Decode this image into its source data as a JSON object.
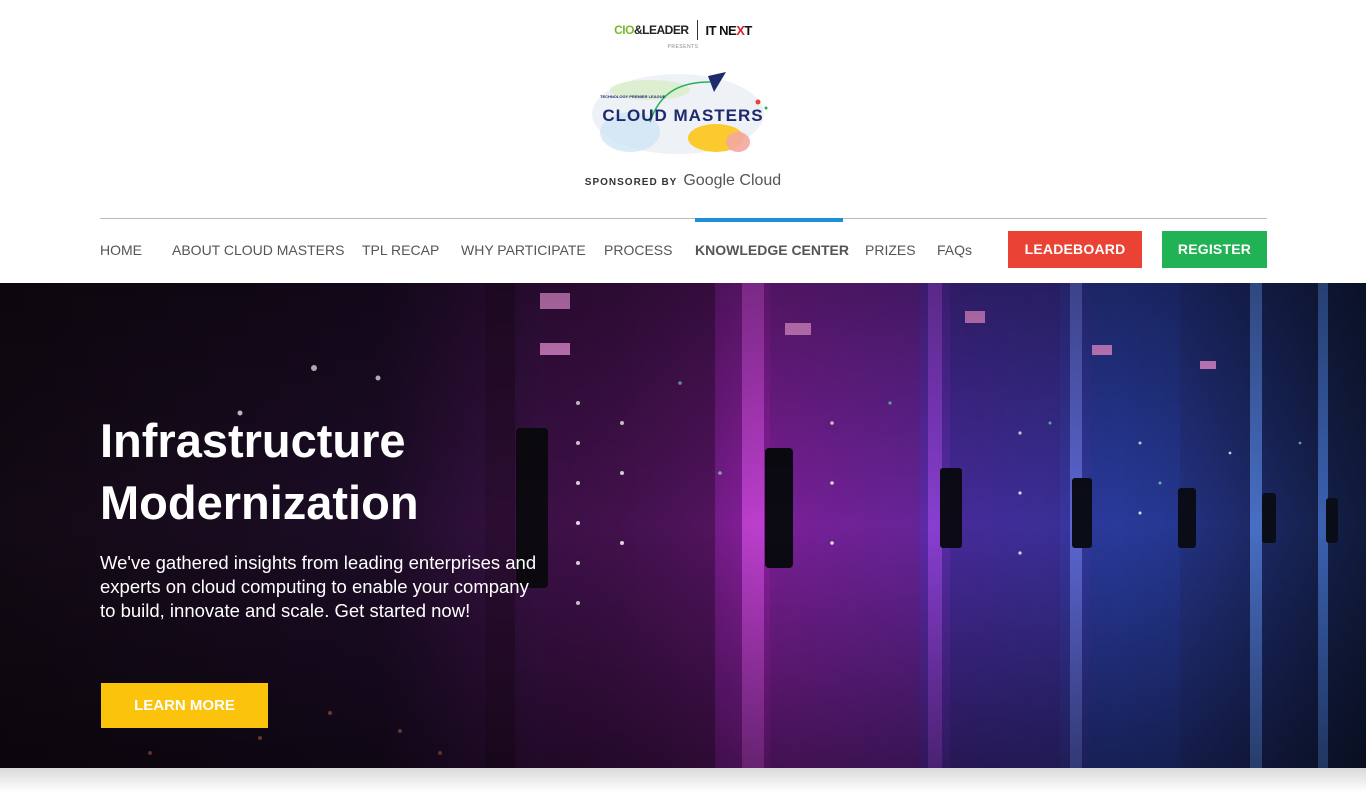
{
  "brand": {
    "cio_a": "CIO",
    "cio_b": "&LEADER",
    "itnext_a": "IT NE",
    "itnext_b": "X",
    "itnext_c": "T",
    "presents": "PRESENTS",
    "logo_tagline": "TECHNOLOGY PREMIER LEAGUE",
    "logo_title": "CLOUD MASTERS",
    "sponsored_by": "SPONSORED BY",
    "sponsor_name": "Google Cloud"
  },
  "nav": {
    "items": [
      {
        "label": "HOME"
      },
      {
        "label": "ABOUT CLOUD MASTERS"
      },
      {
        "label": "TPL RECAP"
      },
      {
        "label": "WHY PARTICIPATE"
      },
      {
        "label": "PROCESS"
      },
      {
        "label": "KNOWLEDGE CENTER",
        "active": true
      },
      {
        "label": "PRIZES"
      },
      {
        "label": "FAQs"
      }
    ],
    "leaderboard": "LEADEBOARD",
    "register": "REGISTER"
  },
  "hero": {
    "title_line1": "Infrastructure",
    "title_line2": "Modernization",
    "description": "We've gathered insights from leading enterprises and experts on cloud computing to enable your company to build, innovate and scale. Get started now!",
    "cta": "LEARN MORE"
  },
  "colors": {
    "leaderboard": "#ea4335",
    "register": "#21b256",
    "cta": "#fbc30b",
    "active_tab": "#1d8fd8"
  }
}
